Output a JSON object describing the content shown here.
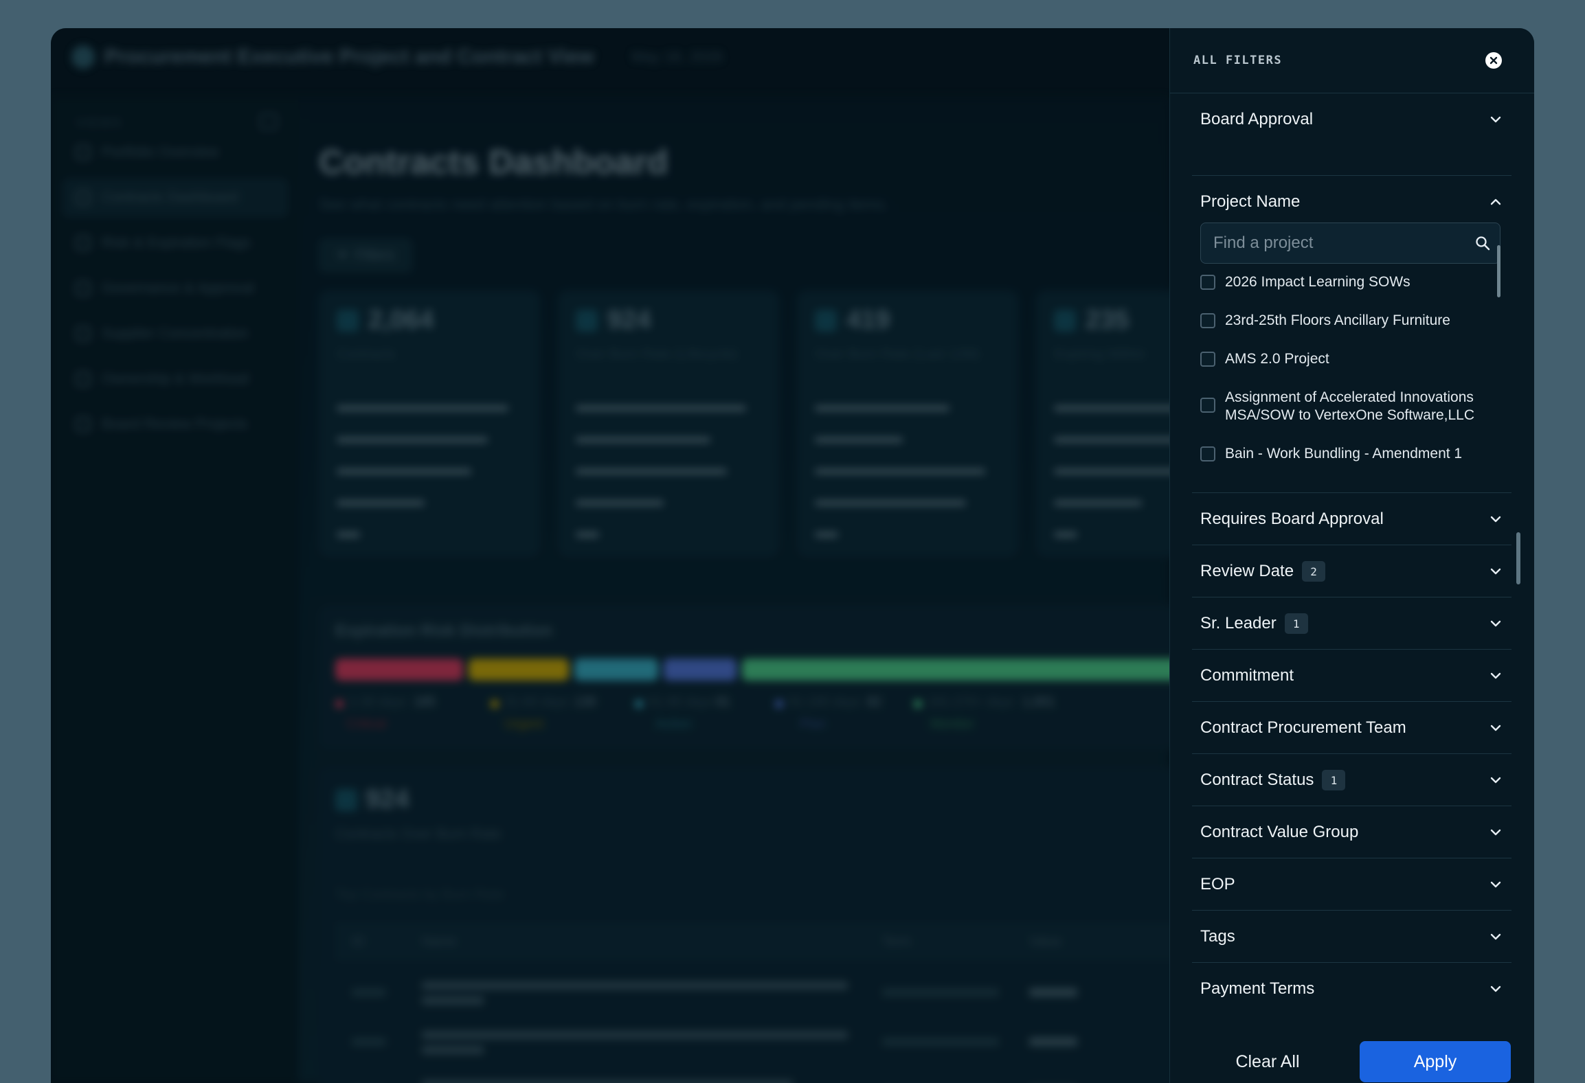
{
  "background_app": {
    "title": "Procurement Executive Project and Contract View",
    "date": "May 18, 2026",
    "sidebar": {
      "heading": "VIEWS",
      "items": [
        {
          "label": "Portfolio Overview"
        },
        {
          "label": "Contracts Dashboard"
        },
        {
          "label": "Risk & Expiration Flags"
        },
        {
          "label": "Governance & Approval"
        },
        {
          "label": "Supplier Concentration"
        },
        {
          "label": "Ownership & Workload"
        },
        {
          "label": "Board Review Projects"
        }
      ]
    },
    "page_title": "Contracts Dashboard",
    "page_subtitle": "See what contracts need attention based on burn rate, expiration, and pending items.",
    "filters_button": "Filters",
    "cards": [
      {
        "value": "2,064",
        "caption": "Contracts"
      },
      {
        "value": "924",
        "caption": "Over Burn Rate (Lifecycle)"
      },
      {
        "value": "419",
        "caption": "Over Burn Rate (Last 12M)"
      },
      {
        "value": "235",
        "caption": "Expiring Within"
      }
    ],
    "distribution_title": "Expiration Risk Distribution",
    "distribution_legend": [
      {
        "range": "1-30 days",
        "count": "185",
        "tag": "Critical",
        "color": "#e23a5c"
      },
      {
        "range": "31-60 days",
        "count": "130",
        "tag": "Urgent",
        "color": "#d8b000"
      },
      {
        "range": "61-90 days",
        "count": "91",
        "tag": "Action",
        "color": "#3bb3c8"
      },
      {
        "range": "91-180 days",
        "count": "82",
        "tag": "Plan",
        "color": "#5577dd"
      },
      {
        "range": "181-270+ days",
        "count": "1,001",
        "tag": "Monitor",
        "color": "#4fd38a"
      }
    ],
    "overburn": {
      "value": "924",
      "caption": "Contracts Over Burn Rate",
      "subtitle": "Top Contracts by Burn Rate",
      "columns": [
        "ID",
        "Name",
        "Term",
        "Value"
      ]
    }
  },
  "panel": {
    "title": "ALL FILTERS",
    "sections": [
      {
        "label": "Board Approval",
        "expanded": false
      },
      {
        "label": "Project Name",
        "expanded": true
      },
      {
        "label": "Requires Board Approval",
        "expanded": false
      },
      {
        "label": "Review Date",
        "badge": "2",
        "expanded": false
      },
      {
        "label": "Sr. Leader",
        "badge": "1",
        "expanded": false
      },
      {
        "label": "Commitment",
        "expanded": false
      },
      {
        "label": "Contract Procurement Team",
        "expanded": false
      },
      {
        "label": "Contract Status",
        "badge": "1",
        "expanded": false
      },
      {
        "label": "Contract Value Group",
        "expanded": false
      },
      {
        "label": "EOP",
        "expanded": false
      },
      {
        "label": "Tags",
        "expanded": false
      },
      {
        "label": "Payment Terms",
        "expanded": false
      }
    ],
    "project_search": {
      "placeholder": "Find a project",
      "value": ""
    },
    "project_options": [
      {
        "label": "2026 Impact Learning SOWs",
        "checked": false
      },
      {
        "label": "23rd-25th Floors Ancillary Furniture",
        "checked": false
      },
      {
        "label": "AMS 2.0 Project",
        "checked": false
      },
      {
        "label": "Assignment of Accelerated Innovations MSA/SOW to VertexOne Software,LLC",
        "checked": false
      },
      {
        "label": "Bain - Work Bundling - Amendment 1",
        "checked": false
      }
    ],
    "footer": {
      "clear_label": "Clear All",
      "apply_label": "Apply"
    },
    "colors": {
      "accent": "#1a63e0",
      "panel_bg": "#071822"
    }
  }
}
